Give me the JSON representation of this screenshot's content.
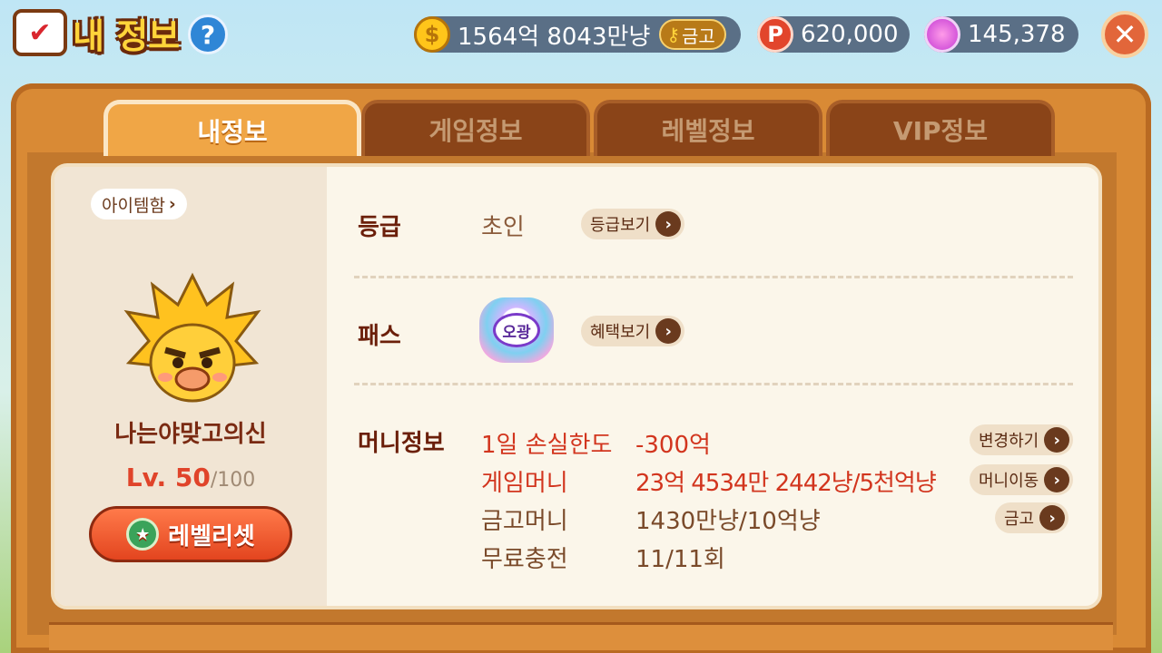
{
  "header": {
    "title": "내 정보",
    "help_label": "?",
    "gold": "1564억 8043만냥",
    "safe_label": "금고",
    "points": "620,000",
    "gems": "145,378",
    "close_label": "✕"
  },
  "tabs": [
    {
      "label": "내정보"
    },
    {
      "label": "게임정보"
    },
    {
      "label": "레벨정보"
    },
    {
      "label": "VIP정보"
    }
  ],
  "profile": {
    "itembox_label": "아이템함",
    "nickname": "나는야맞고의신",
    "level_label": "Lv. 50",
    "level_max": "/100",
    "reset_label": "레벨리셋"
  },
  "grade": {
    "label": "등급",
    "value": "초인",
    "button": "등급보기"
  },
  "pass": {
    "label": "패스",
    "badge_text": "오광",
    "button": "혜택보기"
  },
  "money": {
    "label": "머니정보",
    "rows": [
      {
        "name": "1일 손실한도",
        "value": "-300억",
        "button": "변경하기"
      },
      {
        "name": "게임머니",
        "value": "23억 4534만 2442냥/5천억냥",
        "button": "머니이동"
      },
      {
        "name": "금고머니",
        "value": "1430만냥/10억냥",
        "button": "금고"
      },
      {
        "name": "무료충전",
        "value": "11/11회",
        "button": ""
      }
    ]
  },
  "colors": {
    "accent_orange": "#f0a646",
    "wood": "#d98a35",
    "red_text": "#d2351e"
  }
}
